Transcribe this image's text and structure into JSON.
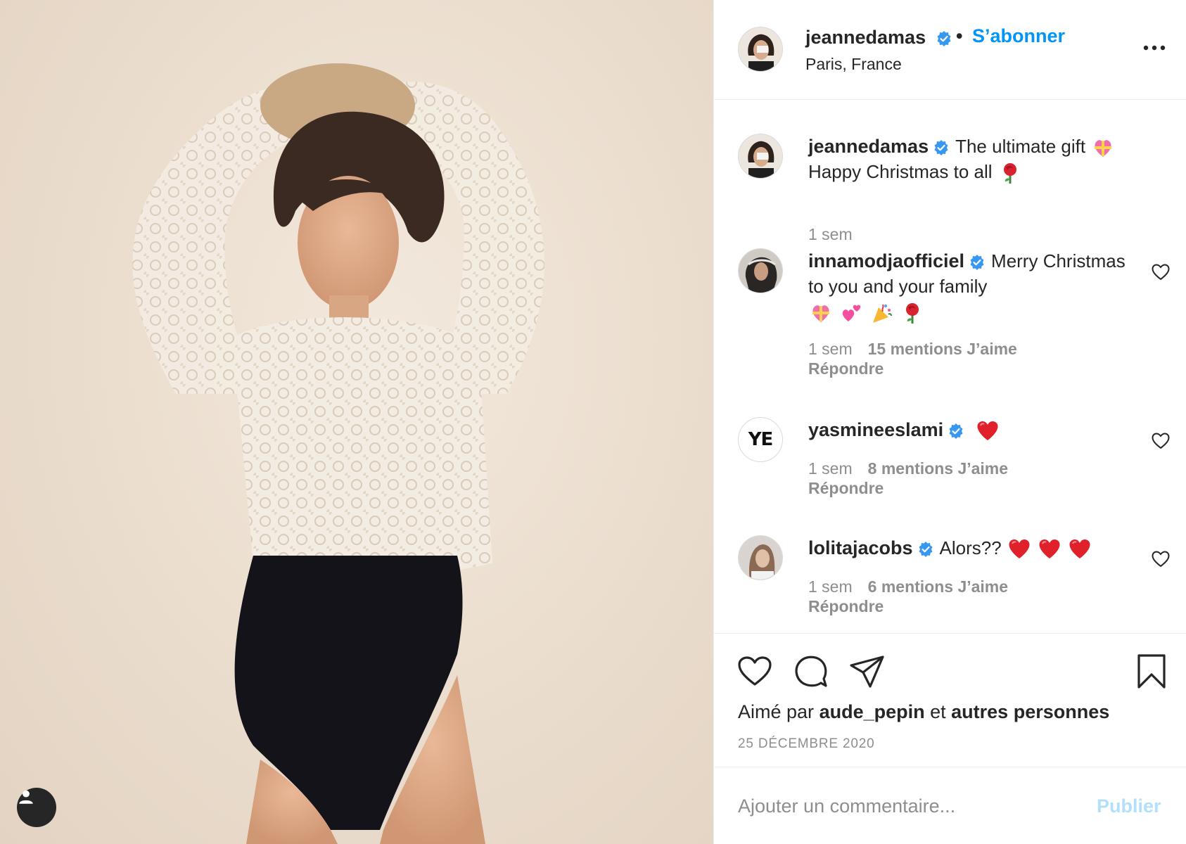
{
  "post": {
    "author": "jeannedamas",
    "follow_separator": "•",
    "follow_label": "S’abonner",
    "location": "Paris, France",
    "more_icon": "more-horizontal-icon"
  },
  "caption": {
    "author": "jeannedamas",
    "text_line1": "The ultimate gift",
    "text_line2": "Happy Christmas to all",
    "emojis": [
      "gift-heart-emoji",
      "rose-emoji"
    ],
    "time": "1 sem"
  },
  "comments": [
    {
      "author": "innamodjaofficiel",
      "text": "Merry Christmas to you and your family",
      "emojis": [
        "gift-heart-emoji",
        "two-hearts-emoji",
        "confetti-emoji",
        "rose-emoji"
      ],
      "time": "1 sem",
      "likes": "15 mentions J’aime",
      "reply": "Répondre"
    },
    {
      "author": "yasmineeslami",
      "avatar_initials": "YE",
      "text": "",
      "emojis": [
        "red-heart-emoji"
      ],
      "time": "1 sem",
      "likes": "8 mentions J’aime",
      "reply": "Répondre"
    },
    {
      "author": "lolitajacobs",
      "text": "Alors??",
      "emojis": [
        "red-heart-emoji",
        "red-heart-emoji",
        "red-heart-emoji"
      ],
      "time": "1 sem",
      "likes": "6 mentions J’aime",
      "reply": "Répondre"
    }
  ],
  "actions": {
    "icons": [
      "heart-icon",
      "comment-icon",
      "share-icon",
      "bookmark-icon"
    ],
    "liked_prefix": "Aimé par",
    "liked_user": "aude_pepin",
    "liked_and": "et",
    "liked_others": "autres personnes",
    "date": "25 DÉCEMBRE 2020"
  },
  "add_comment": {
    "placeholder": "Ajouter un commentaire...",
    "publish_label": "Publier"
  },
  "colors": {
    "accent": "#0095f6",
    "publish_disabled": "#b2dffc",
    "muted": "#8e8e8e",
    "text": "#262626",
    "verified": "#3897f0"
  }
}
